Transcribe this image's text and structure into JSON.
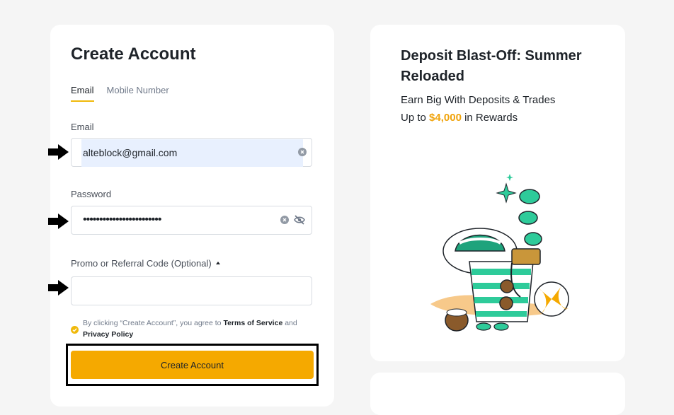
{
  "signup": {
    "title": "Create Account",
    "tabs": [
      {
        "label": "Email",
        "active": true
      },
      {
        "label": "Mobile Number",
        "active": false
      }
    ],
    "email": {
      "label": "Email",
      "value": "alteblock@gmail.com"
    },
    "password": {
      "label": "Password",
      "masked_value": "••••••••••••••••••••••••"
    },
    "promo": {
      "label": "Promo or Referral Code (Optional)",
      "toggle_icon": "caret-up-icon",
      "value": ""
    },
    "terms": {
      "prefix": "By clicking “Create Account”, you agree to ",
      "tos": "Terms of Service",
      "and": " and",
      "privacy": "Privacy Policy",
      "checked": true
    },
    "submit_label": "Create Account"
  },
  "promo_card": {
    "title": "Deposit Blast-Off: Summer Reloaded",
    "line1": "Earn Big With Deposits & Trades",
    "line2_prefix": "Up to ",
    "line2_amount": "$4,000",
    "line2_suffix": " in Rewards"
  },
  "colors": {
    "accent": "#f0b90b",
    "button": "#f5a900",
    "amount": "#f0a30b",
    "autofill": "#e8f0fe"
  }
}
